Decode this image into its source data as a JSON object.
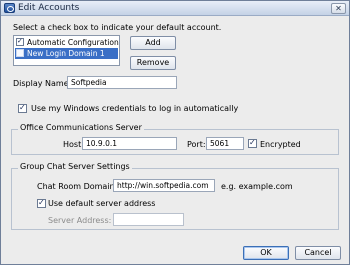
{
  "window": {
    "title": "Edit Accounts"
  },
  "instruction": "Select a check box to indicate your default account.",
  "accounts": [
    {
      "label": "Automatic Configuration",
      "checked": true,
      "selected": false
    },
    {
      "label": "New Login Domain 1",
      "checked": false,
      "selected": true
    }
  ],
  "buttons": {
    "add": "Add",
    "remove": "Remove",
    "ok": "OK",
    "cancel": "Cancel"
  },
  "display_name": {
    "label": "Display Name:",
    "value": "Softpedia"
  },
  "windows_credentials": {
    "label": "Use my Windows credentials to log in automatically",
    "checked": true
  },
  "ocs": {
    "group_label": "Office Communications Server",
    "host_label": "Host:",
    "host_value": "10.9.0.1",
    "port_label": "Port:",
    "port_value": "5061",
    "encrypted_label": "Encrypted",
    "encrypted_checked": true
  },
  "group_chat": {
    "group_label": "Group Chat Server Settings",
    "domain_label": "Chat Room Domain:",
    "domain_value": "http://win.softpedia.com",
    "domain_example": "e.g. example.com",
    "default_server_label": "Use default server address",
    "default_server_checked": true,
    "server_address_label": "Server Address:",
    "server_address_value": ""
  },
  "colors": {
    "selection": "#3a6fc6",
    "window_bg": "#ececec",
    "frame": "#6f7f99"
  }
}
